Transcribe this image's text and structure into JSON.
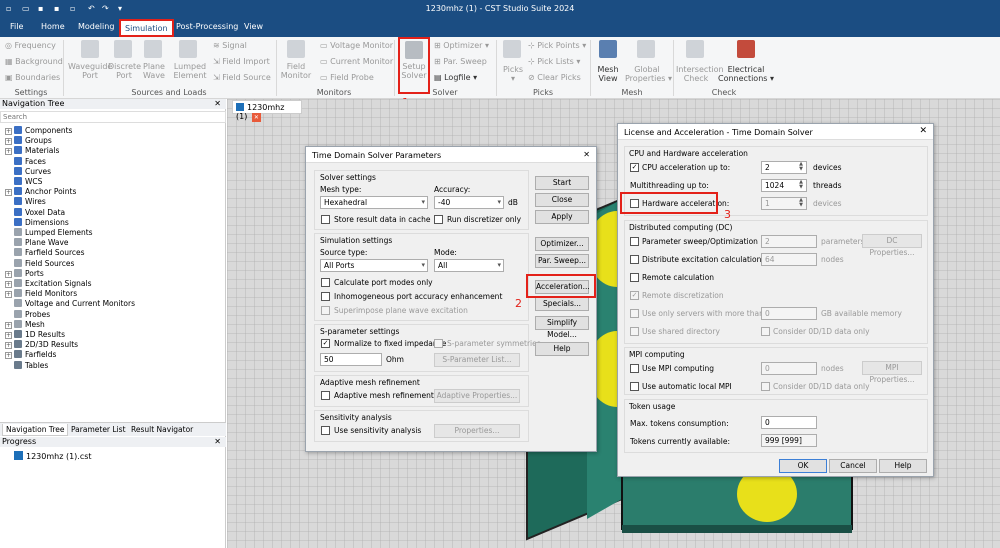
{
  "app": {
    "title": "1230mhz (1) - CST Studio Suite 2024"
  },
  "menu": [
    {
      "label": "File"
    },
    {
      "label": "Home"
    },
    {
      "label": "Modeling"
    },
    {
      "label": "Simulation"
    },
    {
      "label": "Post-Processing"
    },
    {
      "label": "View"
    }
  ],
  "ribbon": {
    "settings": {
      "items": [
        "Frequency",
        "Background",
        "Boundaries"
      ],
      "group_label": "Settings"
    },
    "sources": {
      "waveguide": [
        "Waveguide",
        "Port"
      ],
      "discrete": [
        "Discrete",
        "Port"
      ],
      "plane": [
        "Plane",
        "Wave"
      ],
      "lumped": [
        "Lumped",
        "Element"
      ],
      "items": [
        "Signal",
        "Field Import",
        "Field Source"
      ],
      "group_label": "Sources and Loads"
    },
    "monitors": {
      "field": [
        "Field",
        "Monitor"
      ],
      "items": [
        "Voltage Monitor",
        "Current Monitor",
        "Field Probe"
      ],
      "group_label": "Monitors"
    },
    "solver": {
      "setup": [
        "Setup",
        "Solver"
      ],
      "items": [
        "Optimizer",
        "Par. Sweep",
        "Logfile"
      ],
      "group_label": "Solver"
    },
    "picks": {
      "picks": "Picks",
      "items": [
        "Pick Points",
        "Pick Lists",
        "Clear Picks"
      ],
      "group_label": "Picks"
    },
    "mesh": {
      "view": [
        "Mesh",
        "View"
      ],
      "global": [
        "Global",
        "Properties"
      ],
      "group_label": "Mesh"
    },
    "check": {
      "intersection": [
        "Intersection",
        "Check"
      ],
      "electrical": [
        "Electrical",
        "Connections"
      ],
      "group_label": "Check"
    }
  },
  "annotations": [
    "1",
    "2",
    "3"
  ],
  "nav": {
    "title": "Navigation Tree",
    "search_placeholder": "Search",
    "items": [
      {
        "label": "Components",
        "exp": true,
        "color": "#3b6fc4"
      },
      {
        "label": "Groups",
        "exp": true,
        "color": "#3b6fc4"
      },
      {
        "label": "Materials",
        "exp": true,
        "color": "#3b6fc4"
      },
      {
        "label": "Faces",
        "exp": false,
        "color": "#3b6fc4"
      },
      {
        "label": "Curves",
        "exp": false,
        "color": "#3b6fc4"
      },
      {
        "label": "WCS",
        "exp": false,
        "color": "#3b6fc4"
      },
      {
        "label": "Anchor Points",
        "exp": true,
        "color": "#3b6fc4"
      },
      {
        "label": "Wires",
        "exp": false,
        "color": "#3b6fc4"
      },
      {
        "label": "Voxel Data",
        "exp": false,
        "color": "#3b6fc4"
      },
      {
        "label": "Dimensions",
        "exp": false,
        "color": "#3b6fc4"
      },
      {
        "label": "Lumped Elements",
        "exp": false,
        "color": "#9aa3ad"
      },
      {
        "label": "Plane Wave",
        "exp": false,
        "color": "#9aa3ad"
      },
      {
        "label": "Farfield Sources",
        "exp": false,
        "color": "#9aa3ad"
      },
      {
        "label": "Field Sources",
        "exp": false,
        "color": "#9aa3ad"
      },
      {
        "label": "Ports",
        "exp": true,
        "color": "#9aa3ad"
      },
      {
        "label": "Excitation Signals",
        "exp": true,
        "color": "#9aa3ad"
      },
      {
        "label": "Field Monitors",
        "exp": true,
        "color": "#9aa3ad"
      },
      {
        "label": "Voltage and Current Monitors",
        "exp": false,
        "color": "#9aa3ad"
      },
      {
        "label": "Probes",
        "exp": false,
        "color": "#9aa3ad"
      },
      {
        "label": "Mesh",
        "exp": true,
        "color": "#9aa3ad"
      },
      {
        "label": "1D Results",
        "exp": true,
        "color": "#6a7b8c"
      },
      {
        "label": "2D/3D Results",
        "exp": true,
        "color": "#6a7b8c"
      },
      {
        "label": "Farfields",
        "exp": true,
        "color": "#6a7b8c"
      },
      {
        "label": "Tables",
        "exp": false,
        "color": "#6a7b8c"
      }
    ],
    "tabs": [
      "Navigation Tree",
      "Parameter List",
      "Result Navigator"
    ]
  },
  "progress": {
    "title": "Progress",
    "file": "1230mhz (1).cst"
  },
  "doc_tab": "1230mhz (1)",
  "tdsp": {
    "title": "Time Domain Solver Parameters",
    "solver_settings": "Solver settings",
    "mesh_type_label": "Mesh type:",
    "mesh_type": "Hexahedral",
    "accuracy_label": "Accuracy:",
    "accuracy": "-40",
    "db": "dB",
    "store_cache": "Store result data in cache",
    "run_discretizer": "Run discretizer only",
    "simulation_settings": "Simulation settings",
    "source_type_label": "Source type:",
    "source_type": "All Ports",
    "mode_label": "Mode:",
    "mode": "All",
    "calc_port_modes": "Calculate port modes only",
    "inhom": "Inhomogeneous port accuracy enhancement",
    "superimpose": "Superimpose plane wave excitation",
    "sparam_settings": "S-parameter settings",
    "normalize": "Normalize to fixed impedance",
    "sparam_sym": "S-parameter symmetries",
    "ohm_value": "50",
    "ohm": "Ohm",
    "sparam_list": "S-Parameter List...",
    "adaptive": "Adaptive mesh refinement",
    "adaptive_cb": "Adaptive mesh refinement",
    "adaptive_props": "Adaptive Properties...",
    "sensitivity": "Sensitivity analysis",
    "sensitivity_cb": "Use sensitivity analysis",
    "properties": "Properties...",
    "buttons": {
      "start": "Start",
      "close": "Close",
      "apply": "Apply",
      "optimizer": "Optimizer...",
      "par_sweep": "Par. Sweep...",
      "acceleration": "Acceleration...",
      "specials": "Specials...",
      "simplify": "Simplify Model...",
      "help": "Help"
    }
  },
  "lic": {
    "title": "License and Acceleration - Time Domain Solver",
    "cpu_hw": "CPU and Hardware acceleration",
    "cpu_accel": "CPU acceleration up to:",
    "cpu_value": "2",
    "devices": "devices",
    "multithread": "Multithreading up to:",
    "mt_value": "1024",
    "threads": "threads",
    "hw_accel": "Hardware acceleration:",
    "hw_value": "1",
    "hw_devices": "devices",
    "dc": "Distributed computing (DC)",
    "param_sweep": "Parameter sweep/Optimization up to:",
    "ps_value": "2",
    "parameters": "parameters",
    "dc_props": "DC Properties...",
    "distribute": "Distribute excitation calculation up to",
    "dist_value": "64",
    "nodes": "nodes",
    "remote_calc": "Remote calculation",
    "remote_disc": "Remote discretization",
    "servers": "Use only servers with more than:",
    "servers_value": "0",
    "gb": "GB available memory",
    "shared": "Use shared directory",
    "consider1": "Consider 0D/1D data only",
    "mpi": "MPI computing",
    "use_mpi": "Use MPI computing",
    "mpi_value": "0",
    "mpi_nodes": "nodes",
    "mpi_props": "MPI Properties...",
    "auto_mpi": "Use automatic local MPI",
    "consider2": "Consider 0D/1D data only",
    "token": "Token usage",
    "max_tokens": "Max. tokens consumption:",
    "max_value": "0",
    "tokens_avail": "Tokens currently available:",
    "avail_value": "999 [999]",
    "ok": "OK",
    "cancel": "Cancel",
    "help": "Help"
  }
}
